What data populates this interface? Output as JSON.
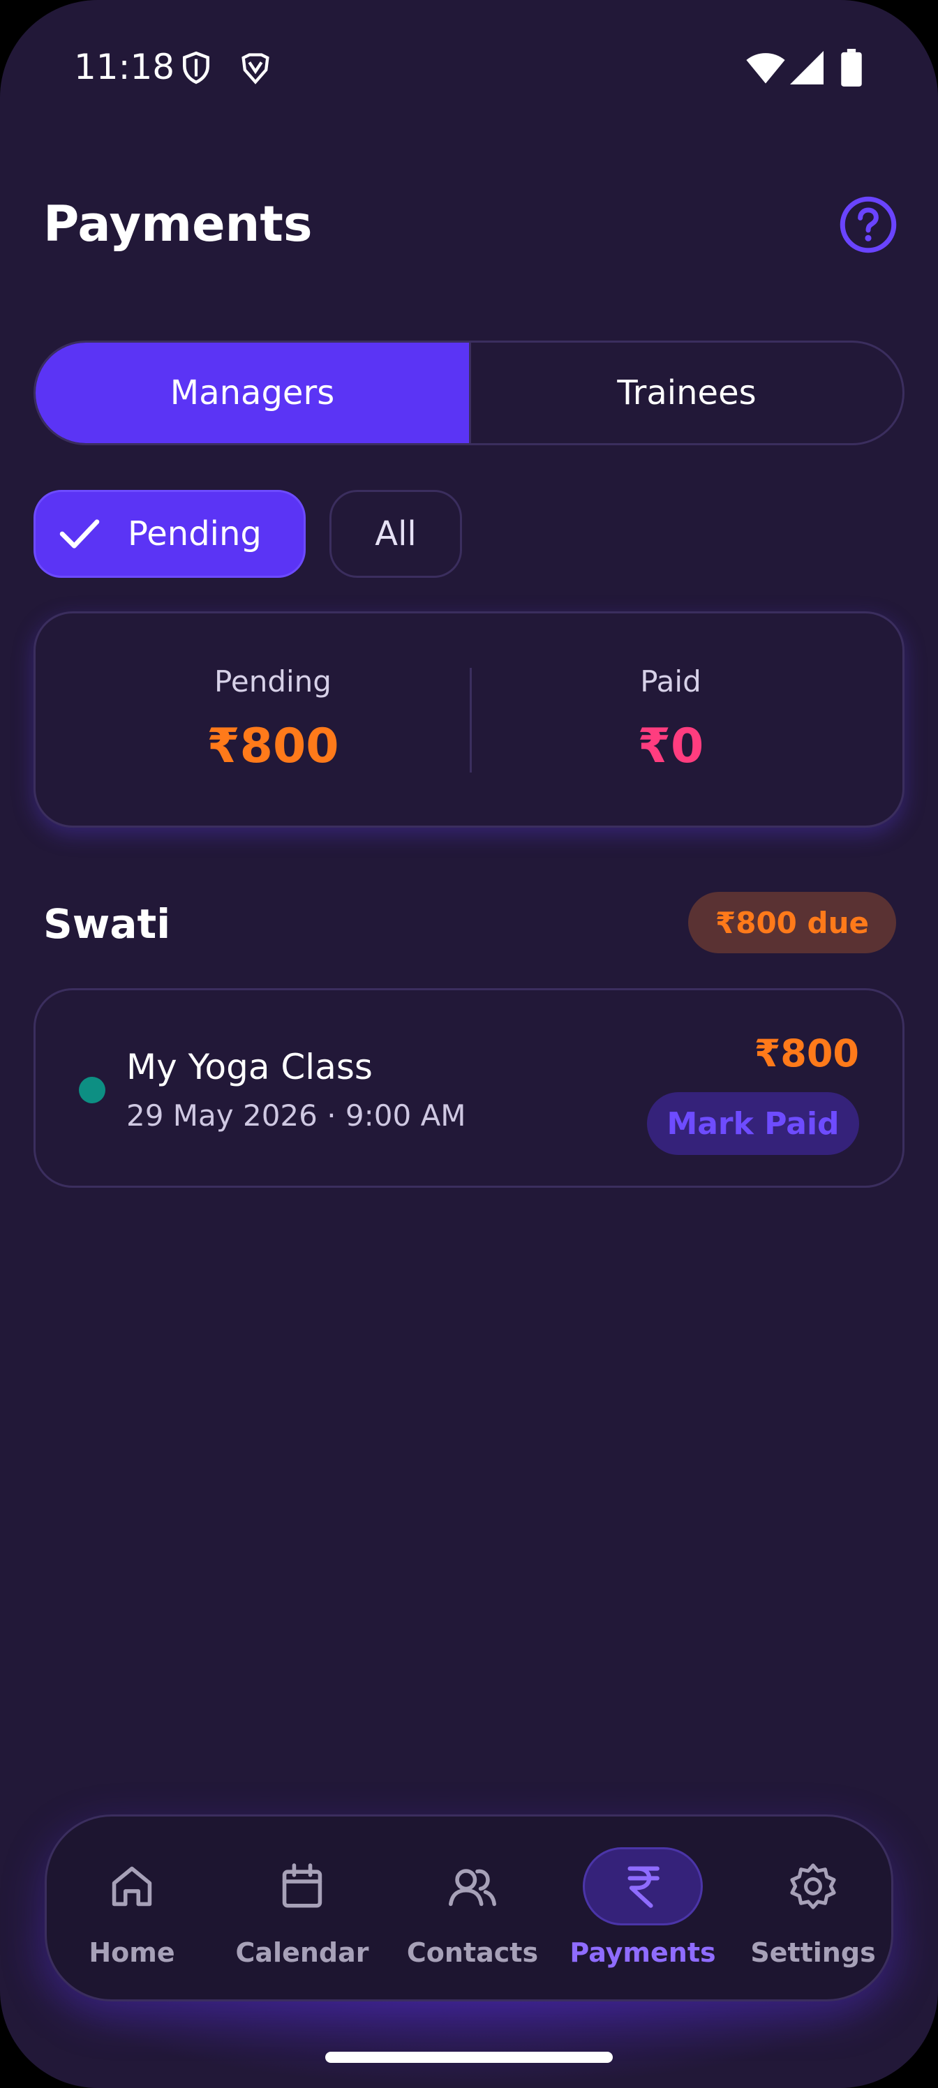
{
  "status_bar": {
    "time": "11:18",
    "icons": [
      "shield-icon",
      "brave-icon",
      "wifi-icon",
      "signal-icon",
      "battery-icon"
    ]
  },
  "header": {
    "title": "Payments",
    "help_icon": "question-circle-icon"
  },
  "tabs": [
    {
      "label": "Managers",
      "active": true
    },
    {
      "label": "Trainees",
      "active": false
    }
  ],
  "filters": [
    {
      "label": "Pending",
      "selected": true
    },
    {
      "label": "All",
      "selected": false
    }
  ],
  "summary": {
    "pending_label": "Pending",
    "pending_value": "₹800",
    "paid_label": "Paid",
    "paid_value": "₹0"
  },
  "groups": [
    {
      "name": "Swati",
      "due_badge": "₹800 due",
      "items": [
        {
          "title": "My Yoga Class",
          "datetime": "29 May 2026 · 9:00 AM",
          "amount": "₹800",
          "action_label": "Mark Paid"
        }
      ]
    }
  ],
  "bottom_nav": [
    {
      "label": "Home",
      "icon": "home-icon",
      "active": false
    },
    {
      "label": "Calendar",
      "icon": "calendar-icon",
      "active": false
    },
    {
      "label": "Contacts",
      "icon": "contacts-icon",
      "active": false
    },
    {
      "label": "Payments",
      "icon": "rupee-icon",
      "active": true
    },
    {
      "label": "Settings",
      "icon": "gear-icon",
      "active": false
    }
  ],
  "colors": {
    "background": "#221838",
    "accent": "#5b34f5",
    "pending": "#ff7a1a",
    "paid": "#ff3d7f",
    "status_dot": "#0d8f83"
  }
}
